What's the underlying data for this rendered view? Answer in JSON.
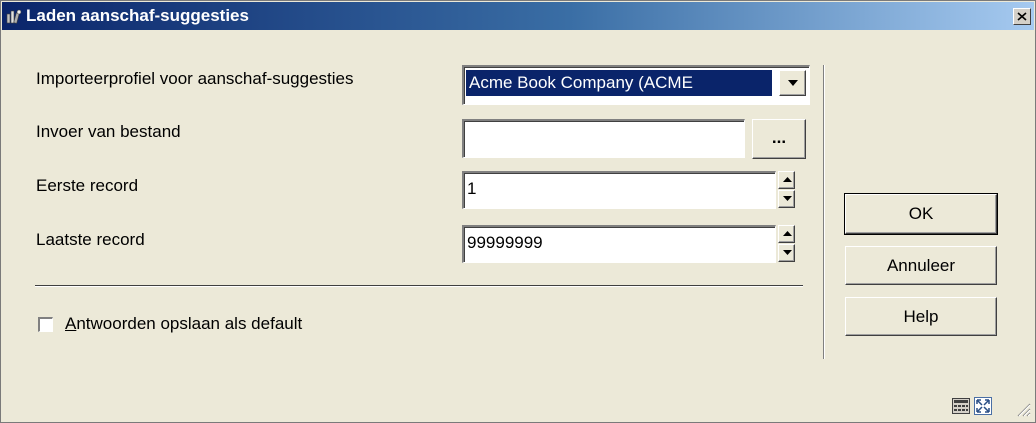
{
  "window": {
    "title": "Laden aanschaf-suggesties",
    "title_icon": "books-icon",
    "close_icon": "close-icon"
  },
  "form": {
    "profile_label": "Importeerprofiel voor aanschaf-suggesties",
    "profile_value": "Acme Book Company (ACME",
    "file_label": "Invoer van bestand",
    "file_value": "",
    "browse_label": "...",
    "first_record_label": "Eerste record",
    "first_record_value": "1",
    "last_record_label": "Laatste record",
    "last_record_value": "99999999",
    "save_default_label": "Antwoorden opslaan als default",
    "save_default_checked": false
  },
  "buttons": {
    "ok": "OK",
    "cancel": "Annuleer",
    "help": "Help"
  },
  "colors": {
    "title_bar_start": "#0a246a",
    "title_bar_end": "#a6caf0",
    "window_bg": "#ece9d8",
    "selection_bg": "#0a246a"
  },
  "statusbar": {
    "icons": [
      "calculator-icon",
      "expand-icon",
      "resize-grip-icon"
    ]
  }
}
